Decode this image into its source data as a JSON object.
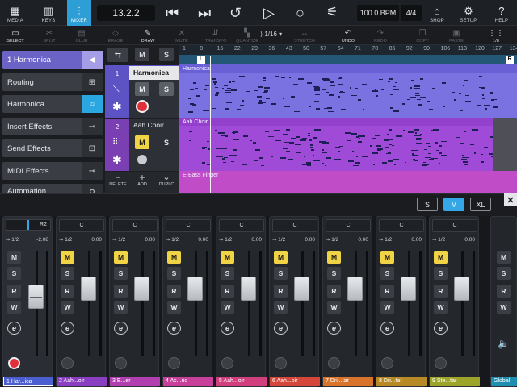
{
  "toolbar_top": {
    "media": "MEDIA",
    "keys": "KEYS",
    "mixer": "MIXER",
    "position": "13.2.2",
    "tempo": "100.0 BPM",
    "signature": "4/4",
    "shop": "SHOP",
    "setup": "SETUP",
    "help": "HELP"
  },
  "tools": {
    "select": "SELECT",
    "split": "SPLIT",
    "glue": "GLUE",
    "erase": "ERASE",
    "draw": "DRAW",
    "mute": "MUTE",
    "transpose": "TRANSPO",
    "quantize": "QUANTIZE",
    "quantize_value": "1/16",
    "stretch": "STRETCH",
    "undo": "UNDO",
    "redo": "REDO",
    "copy": "COPY",
    "paste": "PASTE",
    "grid": "1/8"
  },
  "left_panel": {
    "track_label": "1 Harmonica",
    "routing": "Routing",
    "instrument": "Harmonica",
    "insert": "Insert Effects",
    "send": "Send Effects",
    "midi": "MIDI Effects",
    "automation": "Automation"
  },
  "track_headers": {
    "t1_num": "1",
    "t1_name": "Harmonica",
    "t2_num": "2",
    "t2_name": "Aah Choir",
    "m": "M",
    "s": "S",
    "delete": "DELETE",
    "add": "ADD",
    "duplicate": "DUPLC"
  },
  "arrange": {
    "ruler": [
      "1",
      "8",
      "15",
      "22",
      "29",
      "36",
      "43",
      "50",
      "57",
      "64",
      "71",
      "78",
      "85",
      "92",
      "99",
      "106",
      "113",
      "120",
      "127",
      "134"
    ],
    "lane1": "Harmonica",
    "lane2": "Aah Choir",
    "lane3": "E-Bass Finger",
    "loc_left": "L",
    "loc_right": "R"
  },
  "mixer_sizes": {
    "s": "S",
    "m": "M",
    "xl": "XL"
  },
  "mixer": {
    "pan": "C",
    "io": "1/2",
    "vol": "0.00",
    "first_vol": "-2.08",
    "first_route": "R2",
    "m": "M",
    "s": "S",
    "r": "R",
    "w": "W",
    "e": "e",
    "strips": [
      {
        "label": "1  Har...ica",
        "color": "#4b5fd0"
      },
      {
        "label": "2  Aah...oir",
        "color": "#8a3fc0"
      },
      {
        "label": "3  E...er",
        "color": "#b23fb0"
      },
      {
        "label": "4  Ac...no",
        "color": "#c8409a"
      },
      {
        "label": "5  Aah...oir",
        "color": "#d23f7e"
      },
      {
        "label": "6  Aah...oir",
        "color": "#d5473a"
      },
      {
        "label": "7  Dri...tar",
        "color": "#d8742c"
      },
      {
        "label": "8  Dri...tar",
        "color": "#b88a25"
      },
      {
        "label": "9  Ste...tar",
        "color": "#9ca52a"
      },
      {
        "label": "Global",
        "color": "#1f8fb0"
      }
    ]
  }
}
